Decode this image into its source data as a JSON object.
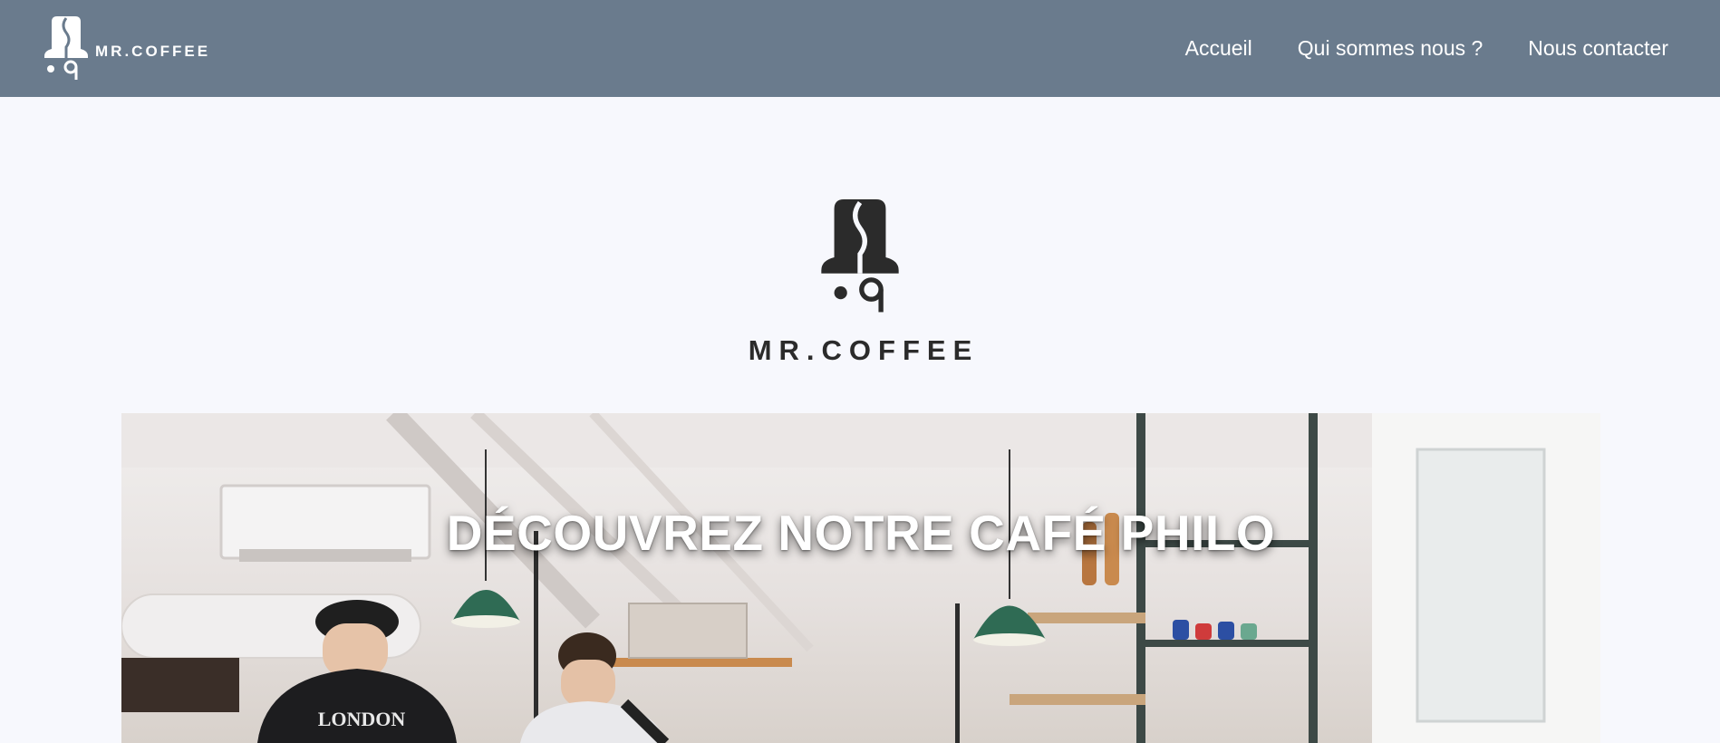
{
  "header": {
    "brand_name": "MR.COFFEE",
    "logo_icon": "coffee-bell-logo",
    "nav": [
      {
        "label": "Accueil"
      },
      {
        "label": "Qui sommes nous ?"
      },
      {
        "label": "Nous contacter"
      }
    ],
    "background_color": "#6a7b8d"
  },
  "hero": {
    "brand_name": "MR.COFFEE",
    "logo_icon": "coffee-bell-logo"
  },
  "banner": {
    "title": "DÉCOUVREZ NOTRE CAFÉ PHILO",
    "shirt_text": "LONDON"
  },
  "colors": {
    "page_background": "#f7f8fd",
    "logo_dark": "#2b2b2b",
    "lamp_green": "#2f6b54"
  }
}
